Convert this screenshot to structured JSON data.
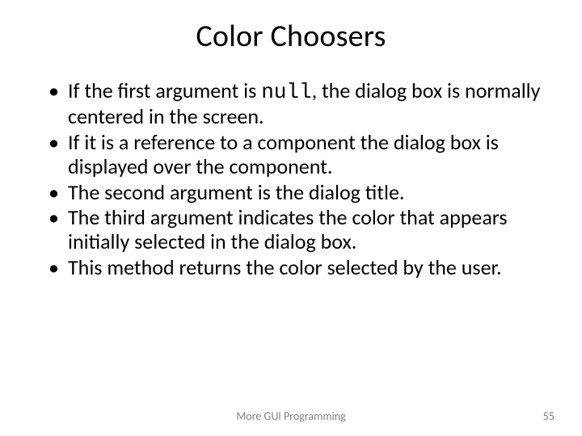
{
  "title": "Color Choosers",
  "bullets": {
    "b1a": "If the first argument is ",
    "b1code": "null",
    "b1b": ", the dialog box is normally centered in the screen.",
    "b2": "If it is a reference to a component the dialog box is displayed over the component.",
    "b3": "The second argument is the dialog title.",
    "b4": "The third argument indicates the color that appears initially selected in the dialog box.",
    "b5": "This method returns the color selected by the user."
  },
  "footer": "More GUI Programming",
  "page": "55"
}
